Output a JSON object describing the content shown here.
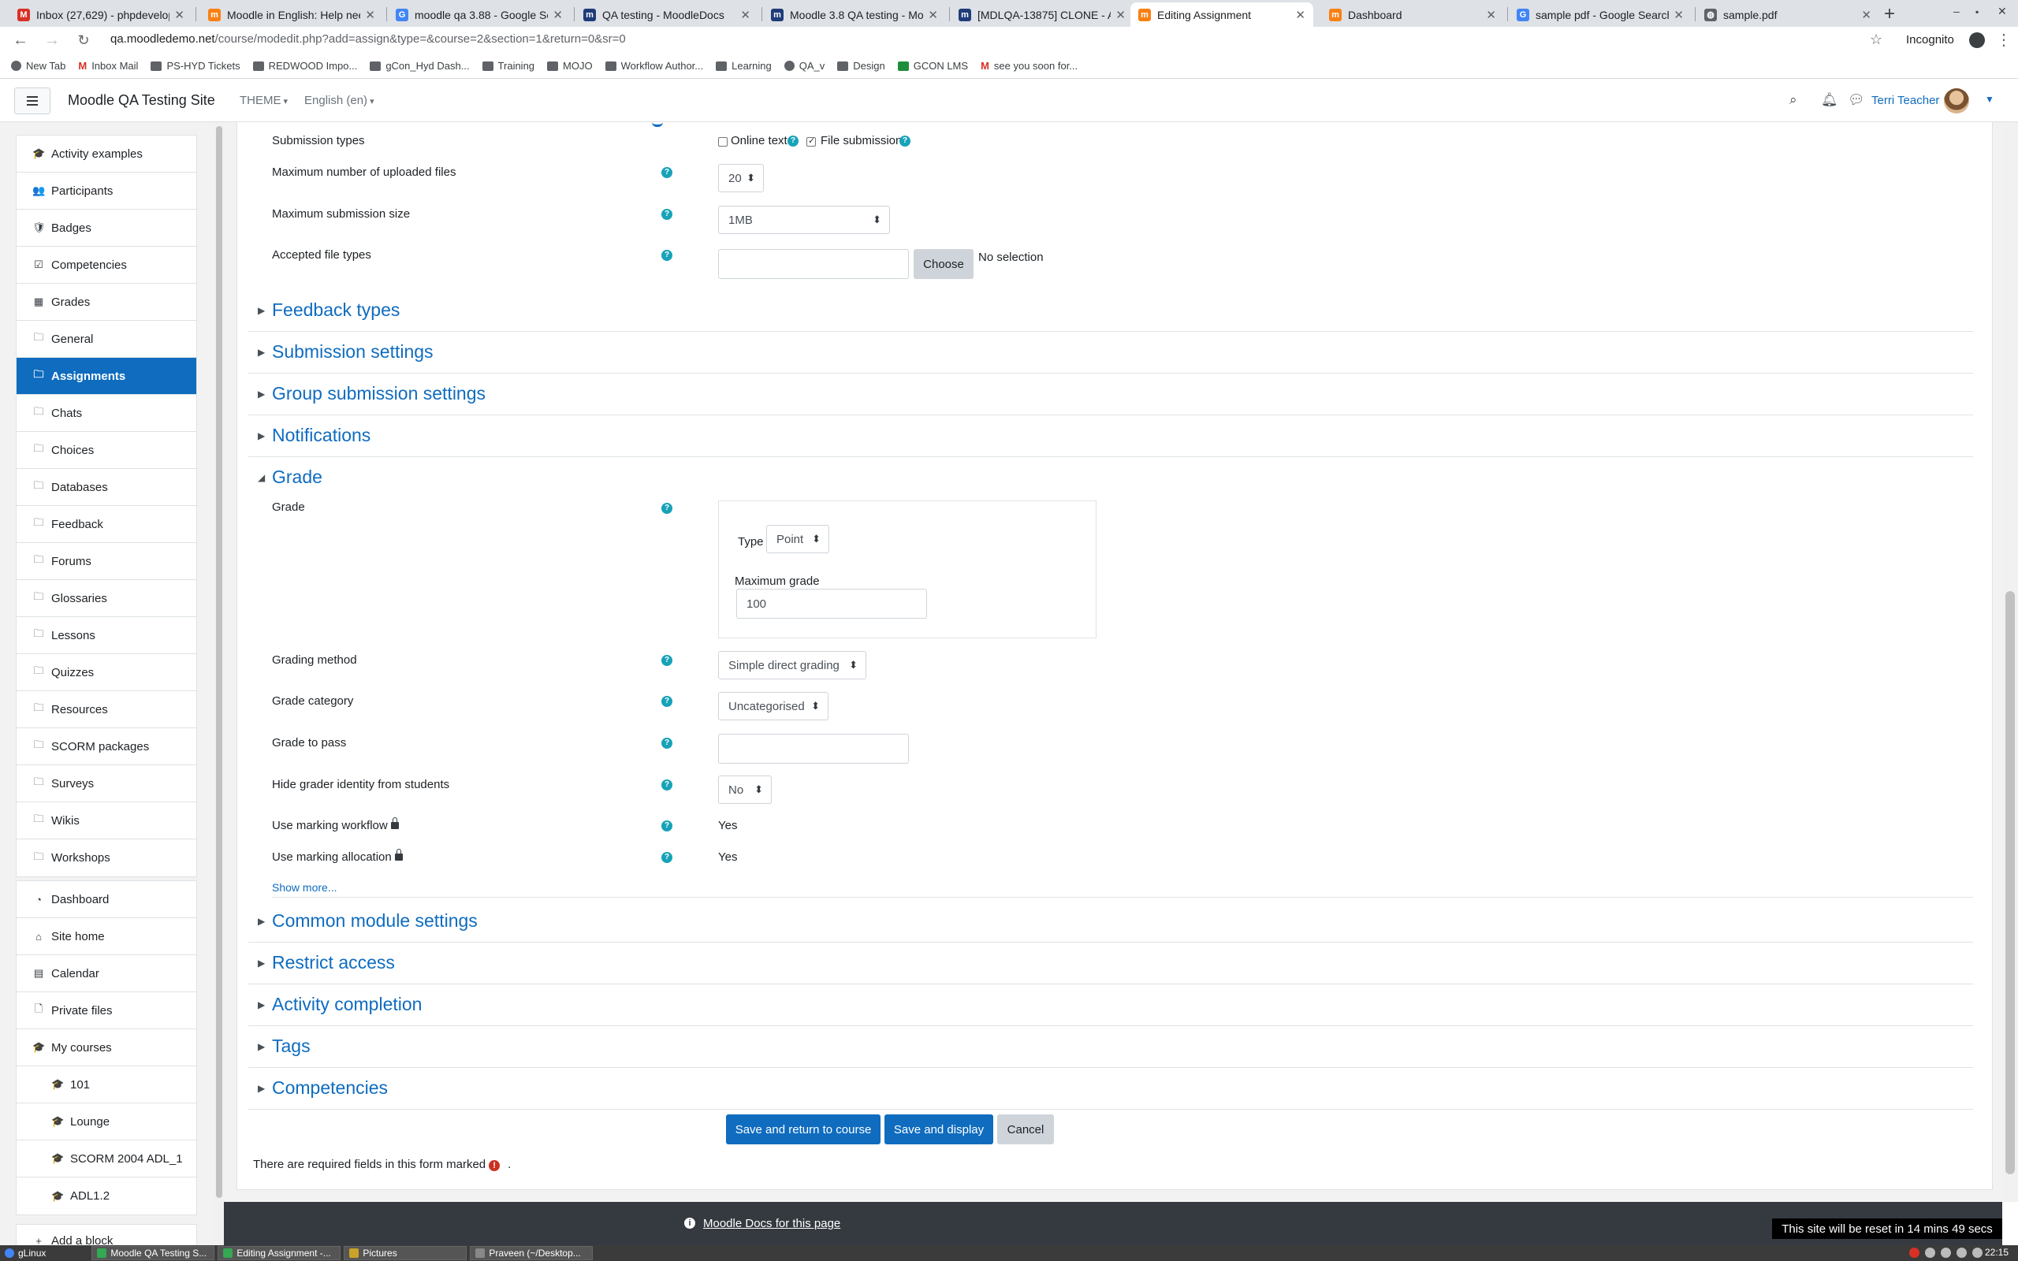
{
  "browser": {
    "tabs": [
      {
        "title": "Inbox (27,629) - phpdevelop",
        "icon": "gmail-icon",
        "color": "#d93025",
        "glyph": "M"
      },
      {
        "title": "Moodle in English: Help nee",
        "icon": "moodle-icon",
        "color": "#f98012",
        "glyph": "m"
      },
      {
        "title": "moodle qa 3.88 - Google Se",
        "icon": "google-icon",
        "color": "#4285f4",
        "glyph": "G"
      },
      {
        "title": "QA testing - MoodleDocs",
        "icon": "moodledocs-icon",
        "color": "#1f3c7a",
        "glyph": "m"
      },
      {
        "title": "Moodle 3.8 QA testing - Moo",
        "icon": "moodledocs-icon",
        "color": "#1f3c7a",
        "glyph": "m"
      },
      {
        "title": "[MDLQA-13875] CLONE - An",
        "icon": "moodledocs-icon",
        "color": "#1f3c7a",
        "glyph": "m"
      },
      {
        "title": "Editing Assignment",
        "icon": "moodle-icon",
        "color": "#f98012",
        "glyph": "m",
        "active": true
      },
      {
        "title": "Dashboard",
        "icon": "moodle-icon",
        "color": "#f98012",
        "glyph": "m"
      },
      {
        "title": "sample pdf - Google Search",
        "icon": "google-icon",
        "color": "#4285f4",
        "glyph": "G"
      },
      {
        "title": "sample.pdf",
        "icon": "globe-icon",
        "color": "#5f6368",
        "glyph": "◍"
      }
    ],
    "url_host": "qa.moodledemo.net",
    "url_path": "/course/modedit.php?add=assign&type=&course=2&section=1&return=0&sr=0",
    "incognito_label": "Incognito",
    "bookmarks": [
      {
        "label": "New Tab",
        "icon": "globe"
      },
      {
        "label": "Inbox Mail",
        "icon": "gmail"
      },
      {
        "label": "PS-HYD Tickets",
        "icon": "folder"
      },
      {
        "label": "REDWOOD Impo...",
        "icon": "folder"
      },
      {
        "label": "gCon_Hyd Dash...",
        "icon": "folder"
      },
      {
        "label": "Training",
        "icon": "folder"
      },
      {
        "label": "MOJO",
        "icon": "folder"
      },
      {
        "label": "Workflow Author...",
        "icon": "folder"
      },
      {
        "label": "Learning",
        "icon": "folder"
      },
      {
        "label": "QA_v",
        "icon": "globe"
      },
      {
        "label": "Design",
        "icon": "folder"
      },
      {
        "label": "GCON LMS",
        "icon": "green"
      },
      {
        "label": "see you soon for...",
        "icon": "gmail"
      }
    ]
  },
  "navbar": {
    "site_name": "Moodle QA Testing Site",
    "theme_menu": "THEME",
    "language_menu": "English (en)",
    "user_name": "Terri Teacher"
  },
  "drawer": {
    "course_items": [
      {
        "label": "Activity examples",
        "icon": "graduation-cap-icon",
        "glyph": "🎓"
      },
      {
        "label": "Participants",
        "icon": "users-icon",
        "glyph": "👥"
      },
      {
        "label": "Badges",
        "icon": "badge-icon",
        "glyph": "🛡"
      },
      {
        "label": "Competencies",
        "icon": "check-square-icon",
        "glyph": "☑"
      },
      {
        "label": "Grades",
        "icon": "table-icon",
        "glyph": "▦"
      },
      {
        "label": "General",
        "icon": "folder-icon",
        "glyph": "🗀"
      },
      {
        "label": "Assignments",
        "icon": "folder-icon",
        "glyph": "🗀",
        "active": true
      },
      {
        "label": "Chats",
        "icon": "folder-icon",
        "glyph": "🗀"
      },
      {
        "label": "Choices",
        "icon": "folder-icon",
        "glyph": "🗀"
      },
      {
        "label": "Databases",
        "icon": "folder-icon",
        "glyph": "🗀"
      },
      {
        "label": "Feedback",
        "icon": "folder-icon",
        "glyph": "🗀"
      },
      {
        "label": "Forums",
        "icon": "folder-icon",
        "glyph": "🗀"
      },
      {
        "label": "Glossaries",
        "icon": "folder-icon",
        "glyph": "🗀"
      },
      {
        "label": "Lessons",
        "icon": "folder-icon",
        "glyph": "🗀"
      },
      {
        "label": "Quizzes",
        "icon": "folder-icon",
        "glyph": "🗀"
      },
      {
        "label": "Resources",
        "icon": "folder-icon",
        "glyph": "🗀"
      },
      {
        "label": "SCORM packages",
        "icon": "folder-icon",
        "glyph": "🗀"
      },
      {
        "label": "Surveys",
        "icon": "folder-icon",
        "glyph": "🗀"
      },
      {
        "label": "Wikis",
        "icon": "folder-icon",
        "glyph": "🗀"
      },
      {
        "label": "Workshops",
        "icon": "folder-icon",
        "glyph": "🗀"
      }
    ],
    "site_items": [
      {
        "label": "Dashboard",
        "icon": "dashboard-icon",
        "glyph": "◔"
      },
      {
        "label": "Site home",
        "icon": "home-icon",
        "glyph": "⌂"
      },
      {
        "label": "Calendar",
        "icon": "calendar-icon",
        "glyph": "▤"
      },
      {
        "label": "Private files",
        "icon": "file-icon",
        "glyph": "🗋"
      },
      {
        "label": "My courses",
        "icon": "graduation-cap-icon",
        "glyph": "🎓"
      },
      {
        "label": "101",
        "icon": "graduation-cap-icon",
        "glyph": "🎓",
        "indent": true
      },
      {
        "label": "Lounge",
        "icon": "graduation-cap-icon",
        "glyph": "🎓",
        "indent": true
      },
      {
        "label": "SCORM 2004 ADL_1",
        "icon": "graduation-cap-icon",
        "glyph": "🎓",
        "indent": true
      },
      {
        "label": "ADL1.2",
        "icon": "graduation-cap-icon",
        "glyph": "🎓",
        "indent": true
      }
    ],
    "add_block": "Add a block"
  },
  "form": {
    "submission_types_label": "Submission types",
    "online_text_label": "Online text",
    "online_text_checked": false,
    "file_submissions_label": "File submissions",
    "file_submissions_checked": true,
    "max_files_label": "Maximum number of uploaded files",
    "max_files_value": "20",
    "max_size_label": "Maximum submission size",
    "max_size_value": "1MB",
    "accepted_types_label": "Accepted file types",
    "choose_button": "Choose",
    "no_selection": "No selection",
    "sections_collapsed_top": [
      "Feedback types",
      "Submission settings",
      "Group submission settings",
      "Notifications"
    ],
    "grade_section": "Grade",
    "grade_label": "Grade",
    "type_label": "Type",
    "type_value": "Point",
    "max_grade_label": "Maximum grade",
    "max_grade_value": "100",
    "grading_method_label": "Grading method",
    "grading_method_value": "Simple direct grading",
    "grade_category_label": "Grade category",
    "grade_category_value": "Uncategorised",
    "grade_to_pass_label": "Grade to pass",
    "grade_to_pass_value": "",
    "hide_grader_label": "Hide grader identity from students",
    "hide_grader_value": "No",
    "marking_workflow_label": "Use marking workflow",
    "marking_workflow_value": "Yes",
    "marking_allocation_label": "Use marking allocation",
    "marking_allocation_value": "Yes",
    "show_more": "Show more...",
    "sections_collapsed_bottom": [
      "Common module settings",
      "Restrict access",
      "Activity completion",
      "Tags",
      "Competencies"
    ],
    "save_return_button": "Save and return to course",
    "save_display_button": "Save and display",
    "cancel_button": "Cancel",
    "required_note": "There are required fields in this form marked",
    "required_note_end": "."
  },
  "footer": {
    "docs_link": "Moodle Docs for this page",
    "reset_notice": "This site will be reset in 14 mins 49 secs"
  },
  "taskbar": {
    "start_label": "gLinux",
    "windows": [
      "Moodle QA Testing S...",
      "Editing Assignment -...",
      "Pictures",
      "Praveen (~/Desktop..."
    ],
    "clock": "22:15"
  },
  "colors": {
    "moodle_blue": "#0f6cbf",
    "help_icon": "#17a2b8",
    "required_icon": "#ca3120",
    "footer_bg": "#343a40"
  }
}
